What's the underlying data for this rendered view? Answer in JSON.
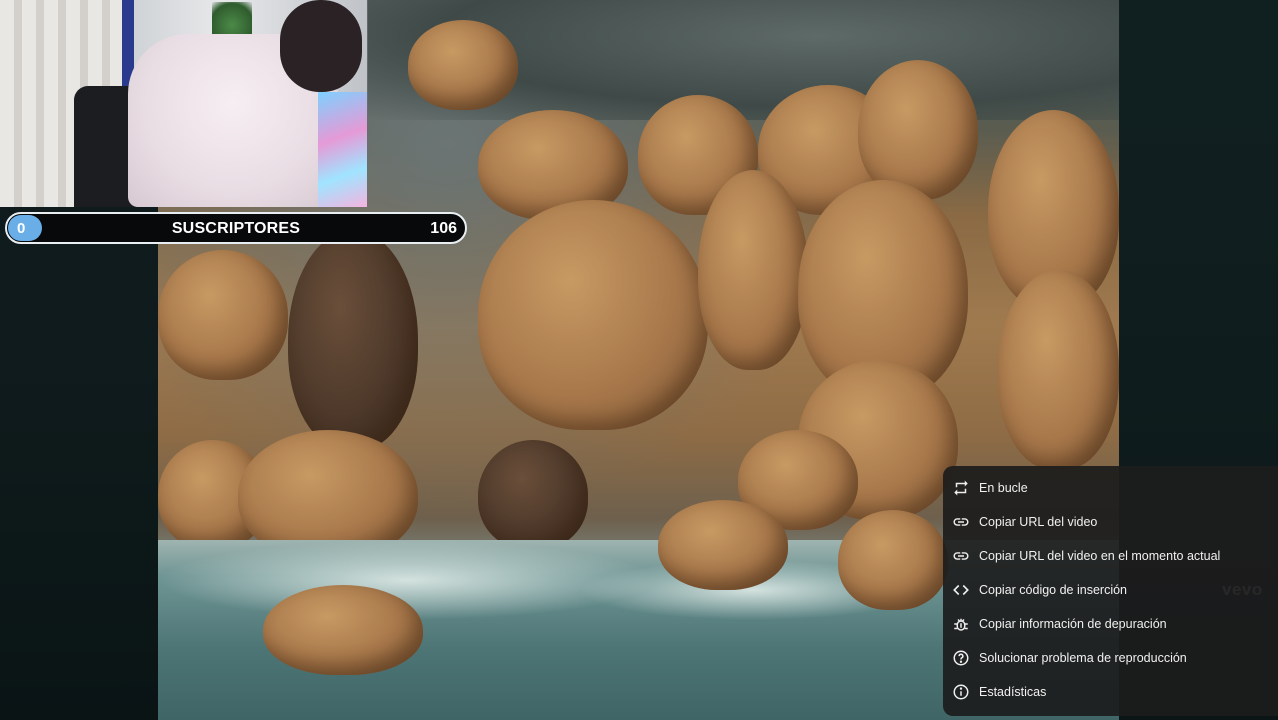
{
  "subscriber_bar": {
    "start": "0",
    "label": "SUSCRIPTORES",
    "goal": "106",
    "progress": 0
  },
  "watermark": "vevo",
  "context_menu": {
    "items": [
      {
        "icon": "loop-icon",
        "label": "En bucle"
      },
      {
        "icon": "link-icon",
        "label": "Copiar URL del video"
      },
      {
        "icon": "link-icon",
        "label": "Copiar URL del video en el momento actual"
      },
      {
        "icon": "embed-code-icon",
        "label": "Copiar código de inserción"
      },
      {
        "icon": "bug-icon",
        "label": "Copiar información de depuración"
      },
      {
        "icon": "help-icon",
        "label": "Solucionar problema de reproducción"
      },
      {
        "icon": "info-icon",
        "label": "Estadísticas"
      }
    ]
  },
  "colors": {
    "progress_pill": "#6aaee8",
    "menu_background": "#1c1c1c"
  }
}
